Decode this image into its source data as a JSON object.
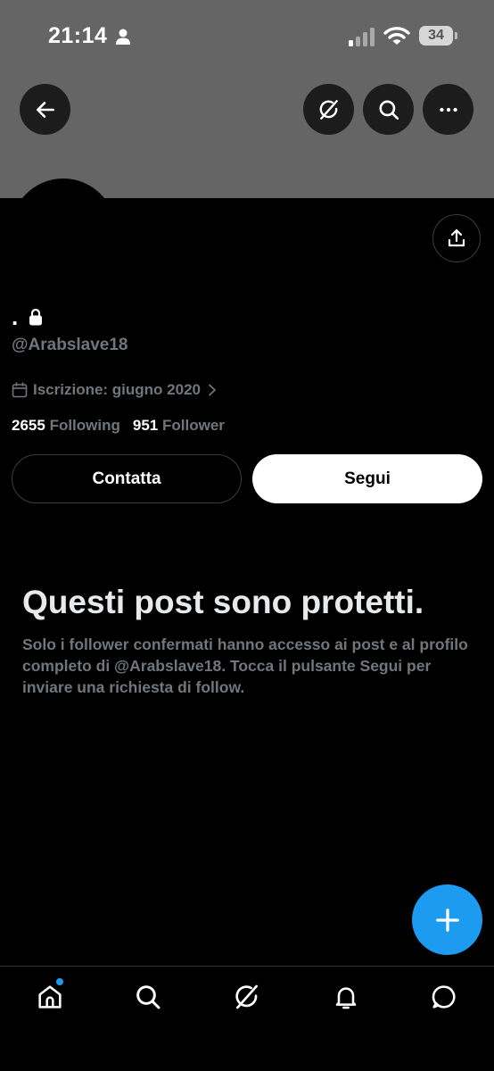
{
  "status_bar": {
    "time": "21:14",
    "battery_level": "34",
    "icons": [
      "person-icon",
      "cellular-signal-icon",
      "wifi-icon",
      "battery-icon"
    ]
  },
  "header": {
    "banner_color": "#656565",
    "buttons": [
      "back-arrow-icon",
      "grok-icon",
      "search-icon",
      "more-icon"
    ]
  },
  "profile": {
    "display_name": ".",
    "handle": "@Arabslave18",
    "joined": "Iscrizione: giugno 2020",
    "following_count": "2655",
    "following_label": "Following",
    "followers_count": "951",
    "followers_label": "Follower"
  },
  "actions": {
    "contact_label": "Contatta",
    "follow_label": "Segui"
  },
  "protected": {
    "title": "Questi post sono protetti.",
    "description": "Solo i follower confermati hanno accesso ai post e al profilo completo di @Arabslave18. Tocca il pulsante Segui per inviare una richiesta di follow."
  },
  "colors": {
    "accent": "#1d9bf0",
    "background": "#000000",
    "secondary_text": "#71767b"
  },
  "bottom_nav": {
    "items": [
      "home-icon",
      "search-icon",
      "grok-icon",
      "notifications-icon",
      "messages-icon"
    ]
  }
}
